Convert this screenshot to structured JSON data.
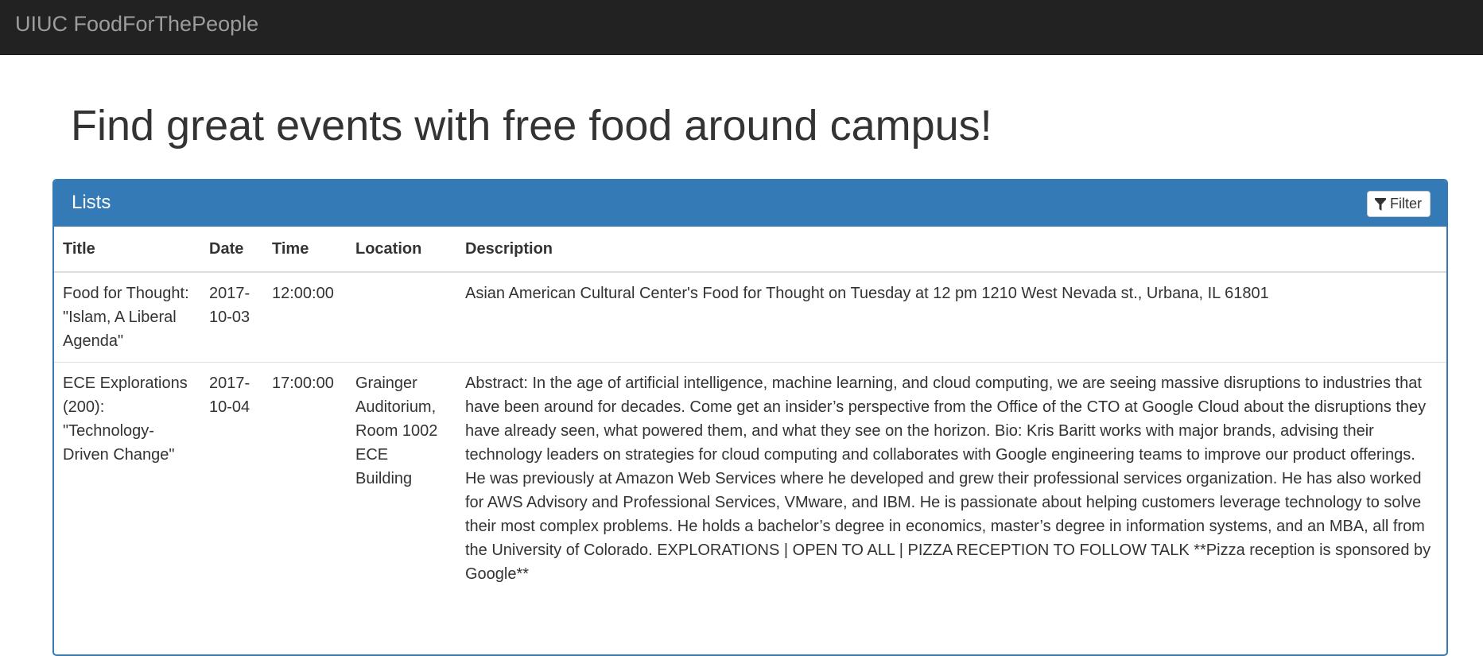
{
  "navbar": {
    "brand": "UIUC FoodForThePeople"
  },
  "page": {
    "title": "Find great events with free food around campus!"
  },
  "panel": {
    "title": "Lists",
    "filter_label": "Filter",
    "filter_icon": "filter-icon"
  },
  "table": {
    "headers": {
      "title": "Title",
      "date": "Date",
      "time": "Time",
      "location": "Location",
      "description": "Description"
    },
    "rows": [
      {
        "title": "Food for Thought: \"Islam, A Liberal Agenda\"",
        "date": "2017-10-03",
        "time": "12:00:00",
        "location": "",
        "description": "Asian American Cultural Center's Food for Thought on Tuesday at 12 pm 1210 West Nevada st., Urbana, IL 61801"
      },
      {
        "title": "ECE Explorations (200): \"Technology-Driven Change\"",
        "date": "2017-10-04",
        "time": "17:00:00",
        "location": "Grainger Auditorium, Room 1002 ECE Building",
        "description": "Abstract: In the age of artificial intelligence, machine learning, and cloud computing, we are seeing massive disruptions to industries that have been around for decades. Come get an insider’s perspective from the Office of the CTO at Google Cloud about the disruptions they have already seen, what powered them, and what they see on the horizon. Bio: Kris Baritt works with major brands, advising their technology leaders on strategies for cloud computing and collaborates with Google engineering teams to improve our product offerings. He was previously at Amazon Web Services where he developed and grew their professional services organization. He has also worked for AWS Advisory and Professional Services, VMware, and IBM. He is passionate about helping customers leverage technology to solve their most complex problems. He holds a bachelor’s degree in economics, master’s degree in information systems, and an MBA, all from the University of Colorado. EXPLORATIONS | OPEN TO ALL | PIZZA RECEPTION TO FOLLOW TALK **Pizza reception is sponsored by Google**"
      }
    ]
  },
  "colors": {
    "navbar_bg": "#222222",
    "brand_text": "#9d9d9d",
    "panel_primary": "#337ab7",
    "text": "#333333",
    "row_border": "#dddddd"
  }
}
